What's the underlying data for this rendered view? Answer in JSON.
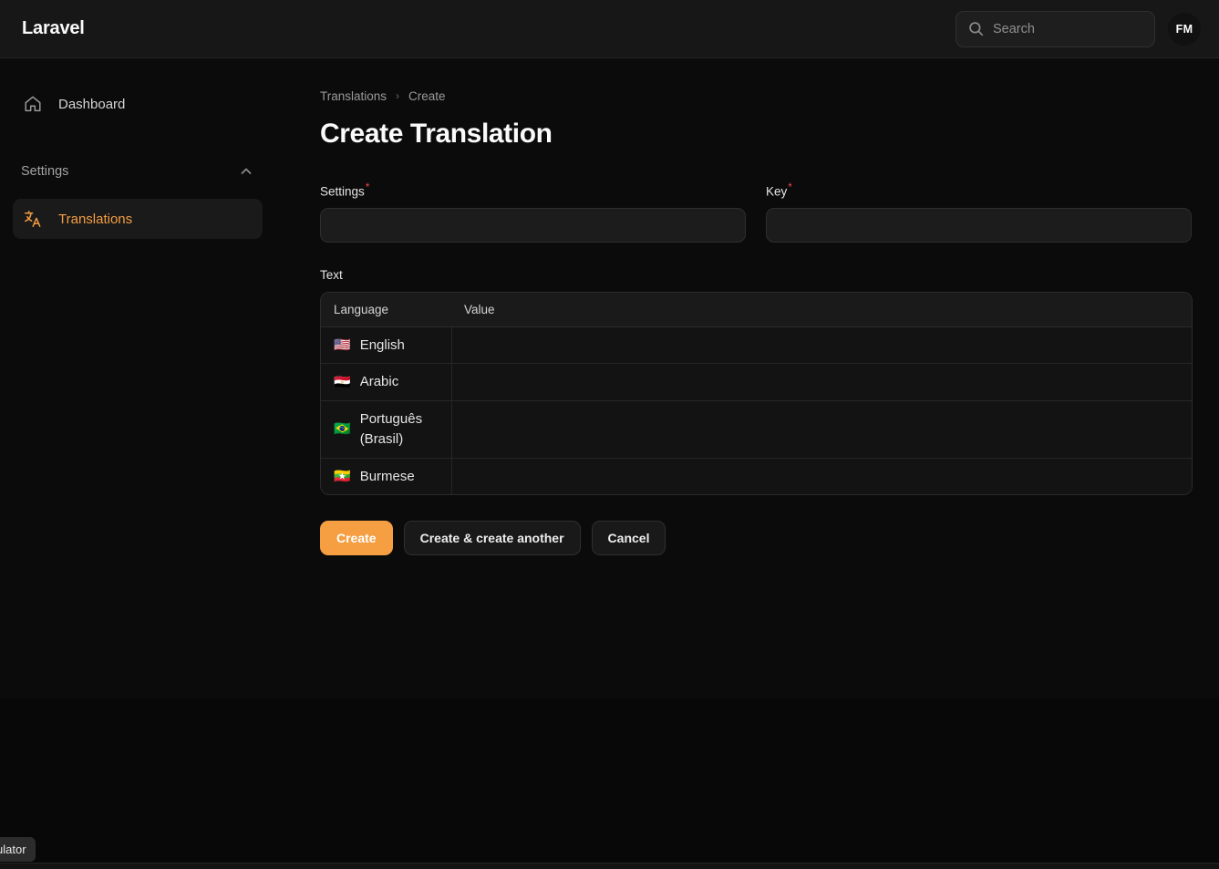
{
  "topbar": {
    "brand": "Laravel",
    "search": {
      "placeholder": "Search",
      "value": "",
      "icon": "search-icon"
    },
    "avatar_initials": "FM"
  },
  "sidebar": {
    "items": [
      {
        "label": "Dashboard",
        "icon": "home-icon",
        "active": false
      }
    ],
    "groups": [
      {
        "title": "Settings",
        "collapse_icon": "chevron-up-icon",
        "items": [
          {
            "label": "Translations",
            "icon": "translate-icon",
            "active": true
          }
        ]
      }
    ]
  },
  "main": {
    "breadcrumb": {
      "parent": "Translations",
      "separator": "›",
      "current": "Create"
    },
    "title": "Create Translation",
    "fields": [
      {
        "label": "Settings",
        "required": true,
        "required_marker": "*",
        "value": "",
        "placeholder": ""
      },
      {
        "label": "Key",
        "required": true,
        "required_marker": "*",
        "value": "",
        "placeholder": ""
      }
    ],
    "text_section": {
      "label": "Text",
      "columns": [
        "Language",
        "Value"
      ],
      "rows": [
        {
          "flag": "🇺🇸",
          "language": "English",
          "value": ""
        },
        {
          "flag": "🇪🇬",
          "language": "Arabic",
          "value": ""
        },
        {
          "flag": "🇧🇷",
          "language": "Português (Brasil)",
          "value": ""
        },
        {
          "flag": "🇲🇲",
          "language": "Burmese",
          "value": ""
        }
      ]
    },
    "actions": [
      {
        "label": "Create",
        "style": "primary"
      },
      {
        "label": "Create & create another",
        "style": "secondary"
      },
      {
        "label": "Cancel",
        "style": "secondary"
      }
    ]
  },
  "overlay": {
    "tooltip_text": "Calculator"
  },
  "colors": {
    "accent": "#f59e42",
    "required": "#ef4444",
    "page_bg": "#0b0b0b",
    "topbar_bg": "#171717"
  }
}
